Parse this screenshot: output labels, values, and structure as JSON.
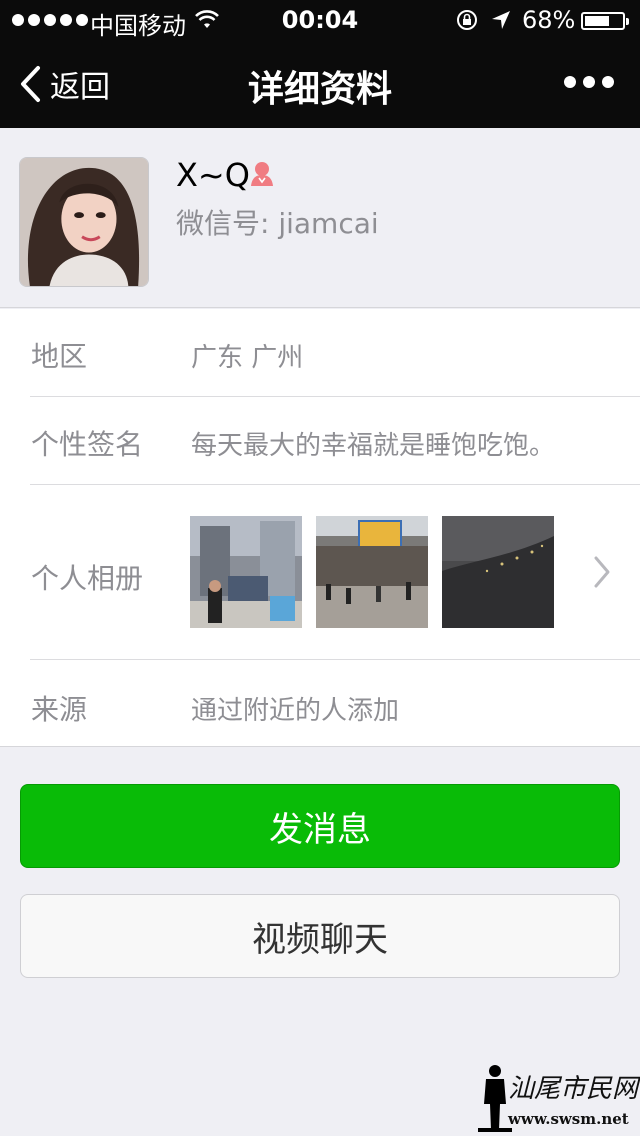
{
  "status_bar": {
    "carrier": "中国移动",
    "time": "00:04",
    "battery_text": "68%",
    "battery_level": 0.68
  },
  "nav": {
    "back_label": "返回",
    "title": "详细资料"
  },
  "profile": {
    "name": "X~Q",
    "gender_icon": "female-icon",
    "wechat_id": "微信号: jiamcai"
  },
  "info": {
    "region": {
      "label": "地区",
      "value": "广东 广州"
    },
    "signature": {
      "label": "个性签名",
      "value": "每天最大的幸福就是睡饱吃饱。"
    },
    "album": {
      "label": "个人相册"
    },
    "source": {
      "label": "来源",
      "value": "通过附近的人添加"
    }
  },
  "actions": {
    "send_message": "发消息",
    "video_chat": "视频聊天"
  },
  "watermark": {
    "brand": "汕尾市民网",
    "url": "www.swsm.net"
  },
  "colors": {
    "primary_green": "#09bb07",
    "nav_bg": "#0b0b0b",
    "page_bg": "#efeff4"
  }
}
